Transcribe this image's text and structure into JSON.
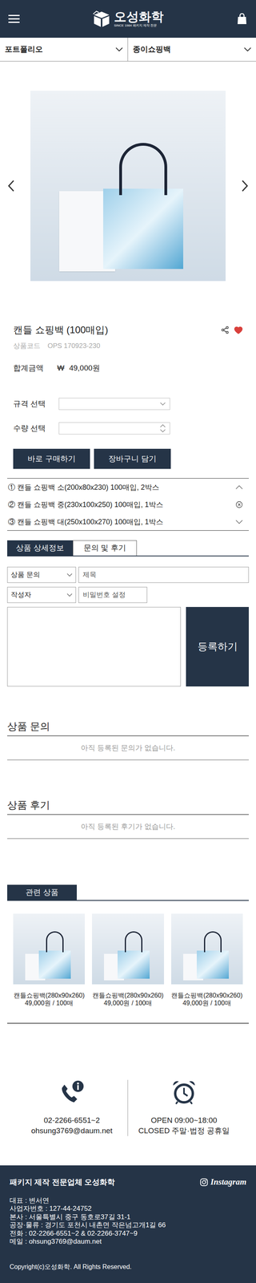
{
  "header": {
    "logo": {
      "name": "오성화학",
      "tagline": "SINCE 1984 패키지 제작 전문"
    }
  },
  "filters": [
    {
      "label": "포트폴리오"
    },
    {
      "label": "종이쇼핑백"
    }
  ],
  "product": {
    "title": "캔들 쇼핑백 (100매입)",
    "liked": true,
    "code_label": "상품코드",
    "code": "OPS 170923-230",
    "total_label": "합계금액",
    "currency": "₩",
    "price": "49,000원"
  },
  "options_form": {
    "size_label": "규격 선택",
    "qty_label": "수량 선택"
  },
  "buttons": [
    "바로 구매하기",
    "장바구니 담기"
  ],
  "selected_items": [
    {
      "text": "① 캔들 쇼핑백 소(200x80x230) 100매입, 2박스",
      "kind": "collapse"
    },
    {
      "text": "② 캔들 쇼핑백 중(230x100x250) 100매입, 1박스",
      "kind": "remove"
    },
    {
      "text": "③ 캔들 쇼핑백 대(250x100x270) 100매입, 1박스",
      "kind": "expand"
    }
  ],
  "tabs": [
    {
      "label": "상품 상세정보",
      "selected": true
    },
    {
      "label": "문의 및 후기",
      "selected": false
    }
  ],
  "inquiry_form": {
    "category": "상품 문의",
    "title_placeholder": "제목",
    "author": "작성자",
    "password_placeholder": "비밀번호 설정",
    "submit": "등록하기"
  },
  "sections": [
    {
      "title": "상품 문의",
      "empty": "아직 등록된 문의가 없습니다."
    },
    {
      "title": "상품 후기",
      "empty": "아직 등록된 후기가 없습니다."
    }
  ],
  "related": {
    "title": "관련 상품",
    "items": [
      {
        "name": "캔들쇼핑백(280x90x260)",
        "price": "49,000원 / 100매"
      },
      {
        "name": "캔들쇼핑백(280x90x260)",
        "price": "49,000원 / 100매"
      },
      {
        "name": "캔들쇼핑백(280x90x260)",
        "price": "49,000원 / 100매"
      }
    ]
  },
  "contact": {
    "phone": "02-2266-6551~2",
    "email": "ohsung3769@daum.net",
    "hours": "OPEN 09:00~18:00",
    "closed": "CLOSED 주말·법정 공휴일"
  },
  "footer": {
    "company": "패키지 제작 전문업체 오성화학",
    "social": "Instagram",
    "lines": [
      "대표 : 변서연",
      "사업자번호 : 127-44-24752",
      "본사 : 서울특별시 중구 동호로37길 31-1",
      "공장·물류 : 경기도 포천시 내촌면 작은넘고개1길 66",
      "전화 : 02-2266-6551~2 & 02-2266-3747~9",
      "메일 : ohsung3769@daum.net"
    ],
    "copyright": "Copyright(c)오성화학. All Rights Reserved."
  }
}
